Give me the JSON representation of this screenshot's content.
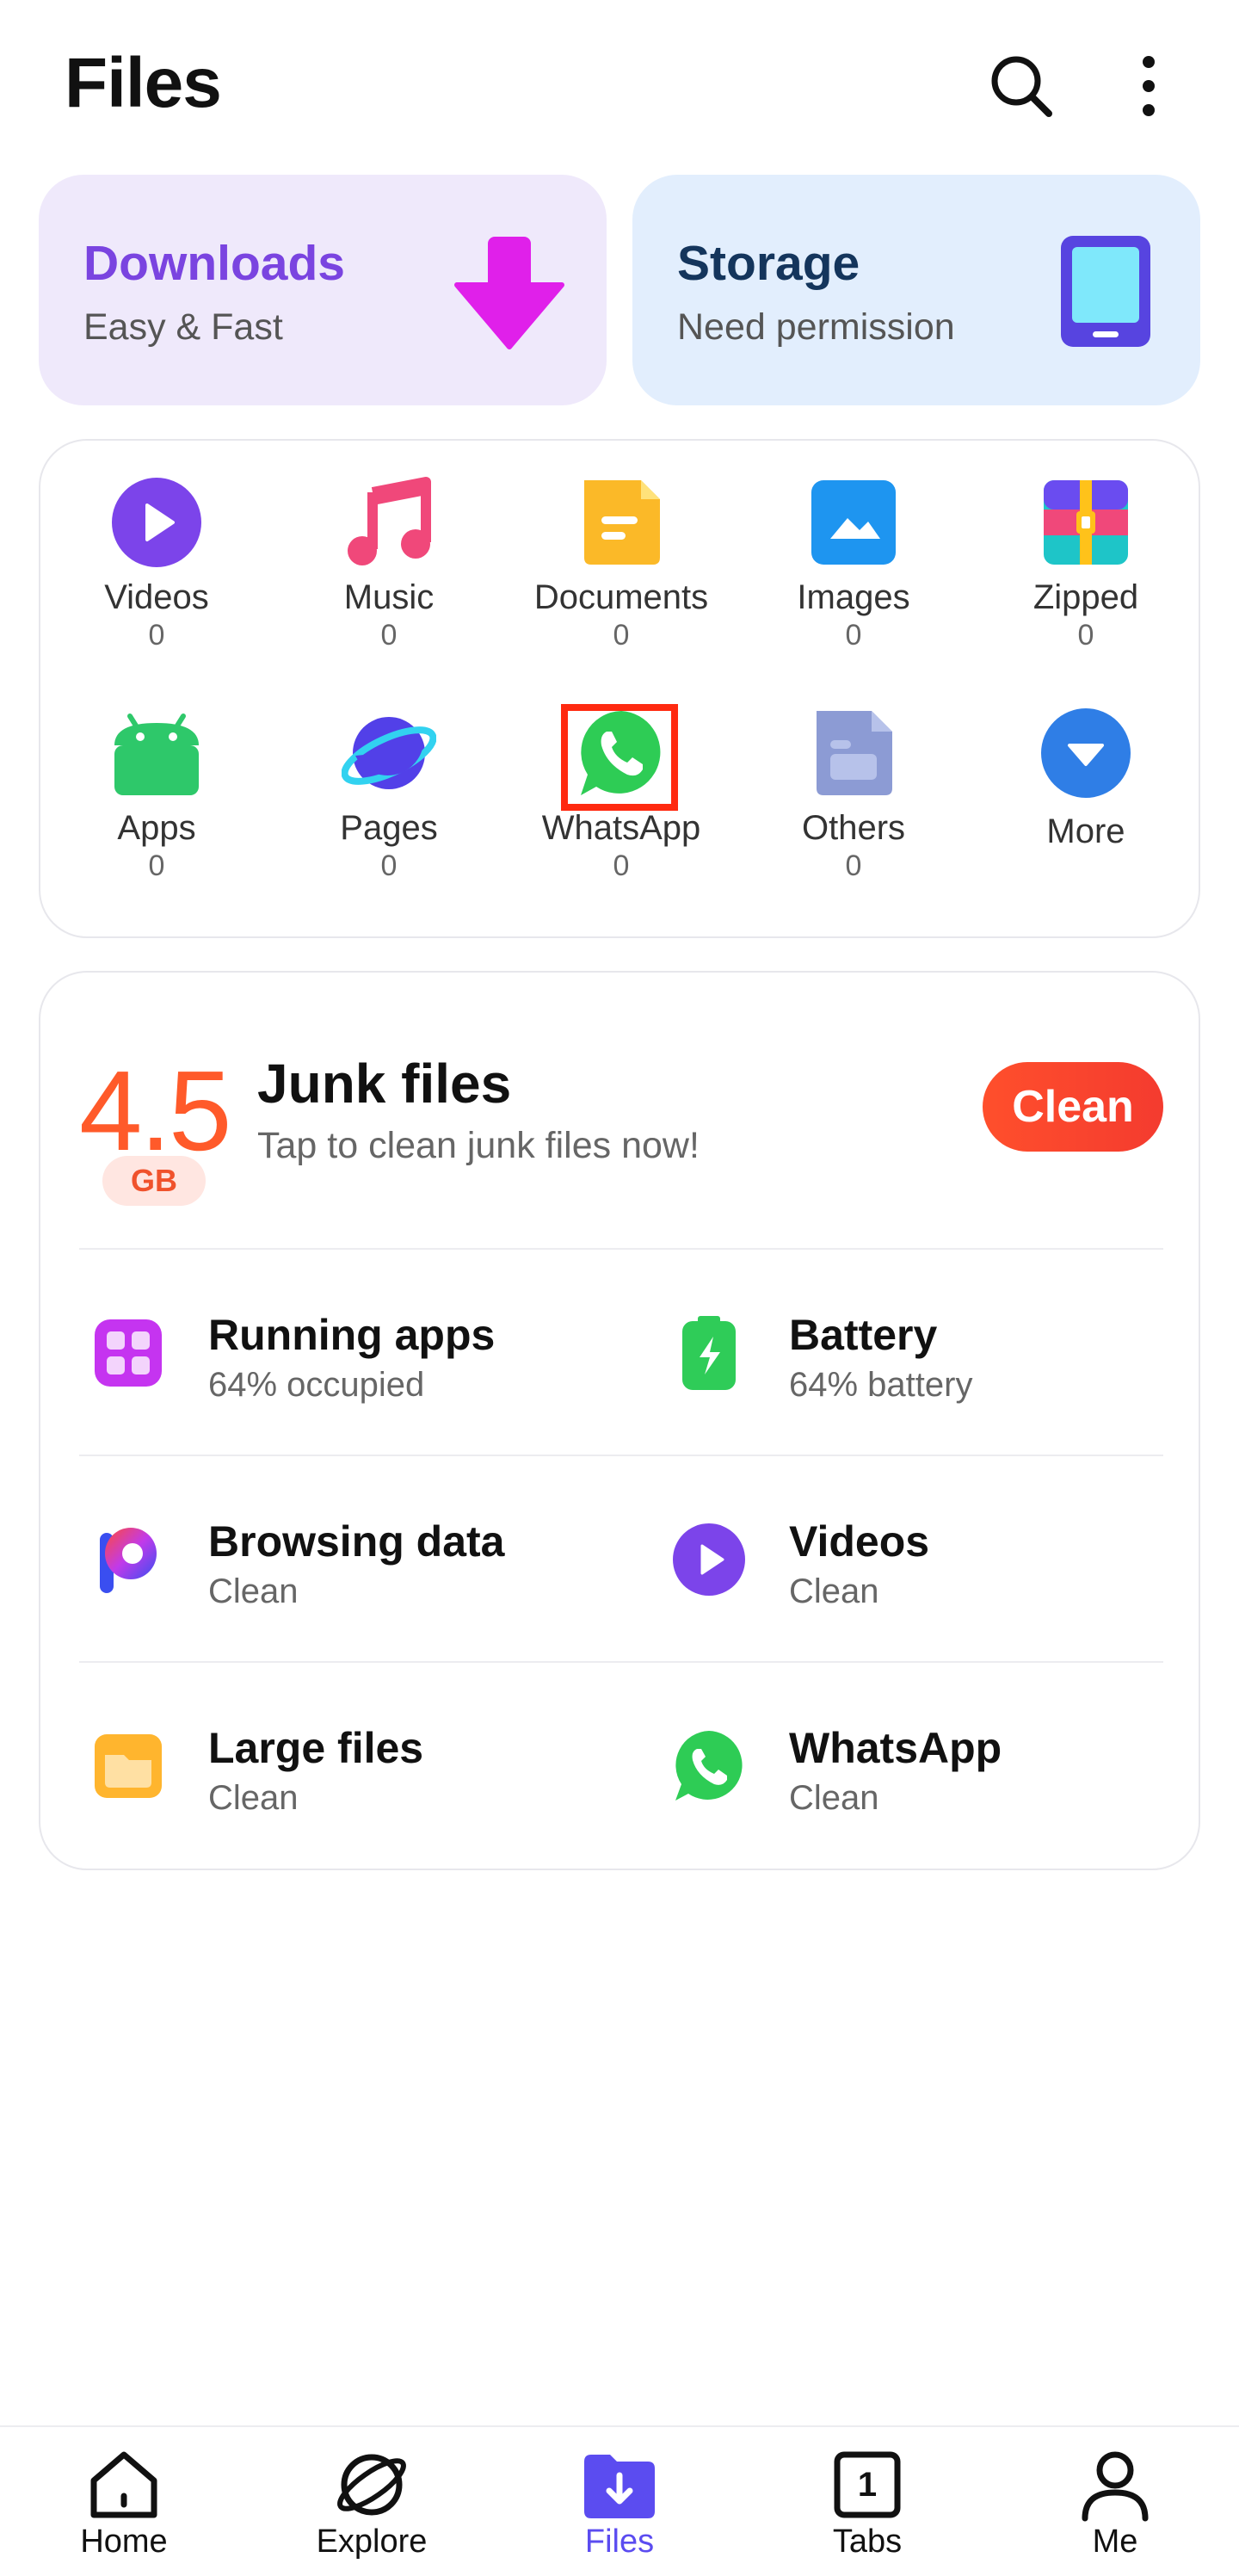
{
  "header": {
    "title": "Files"
  },
  "cards": {
    "downloads": {
      "title": "Downloads",
      "subtitle": "Easy & Fast"
    },
    "storage": {
      "title": "Storage",
      "subtitle": "Need permission"
    }
  },
  "categories": [
    {
      "label": "Videos",
      "count": "0"
    },
    {
      "label": "Music",
      "count": "0"
    },
    {
      "label": "Documents",
      "count": "0"
    },
    {
      "label": "Images",
      "count": "0"
    },
    {
      "label": "Zipped",
      "count": "0"
    },
    {
      "label": "Apps",
      "count": "0"
    },
    {
      "label": "Pages",
      "count": "0"
    },
    {
      "label": "WhatsApp",
      "count": "0"
    },
    {
      "label": "Others",
      "count": "0"
    },
    {
      "label": "More"
    }
  ],
  "junk": {
    "amount": "4.5",
    "unit": "GB",
    "title": "Junk files",
    "subtitle": "Tap to clean junk files now!",
    "clean_label": "Clean"
  },
  "items": [
    {
      "title": "Running apps",
      "subtitle": "64% occupied"
    },
    {
      "title": "Battery",
      "subtitle": "64% battery"
    },
    {
      "title": "Browsing data",
      "subtitle": "Clean"
    },
    {
      "title": "Videos",
      "subtitle": "Clean"
    },
    {
      "title": "Large files",
      "subtitle": "Clean"
    },
    {
      "title": "WhatsApp",
      "subtitle": "Clean"
    }
  ],
  "nav": [
    {
      "label": "Home"
    },
    {
      "label": "Explore"
    },
    {
      "label": "Files"
    },
    {
      "label": "Tabs",
      "badge": "1"
    },
    {
      "label": "Me"
    }
  ],
  "colors": {
    "accent": "#5b4cf0",
    "downloads_card": "#efe9fb",
    "storage_card": "#e2eefd",
    "clean_button": "#f64a2d",
    "junk_number": "#ff5a2a",
    "highlight": "#ff2a10"
  }
}
